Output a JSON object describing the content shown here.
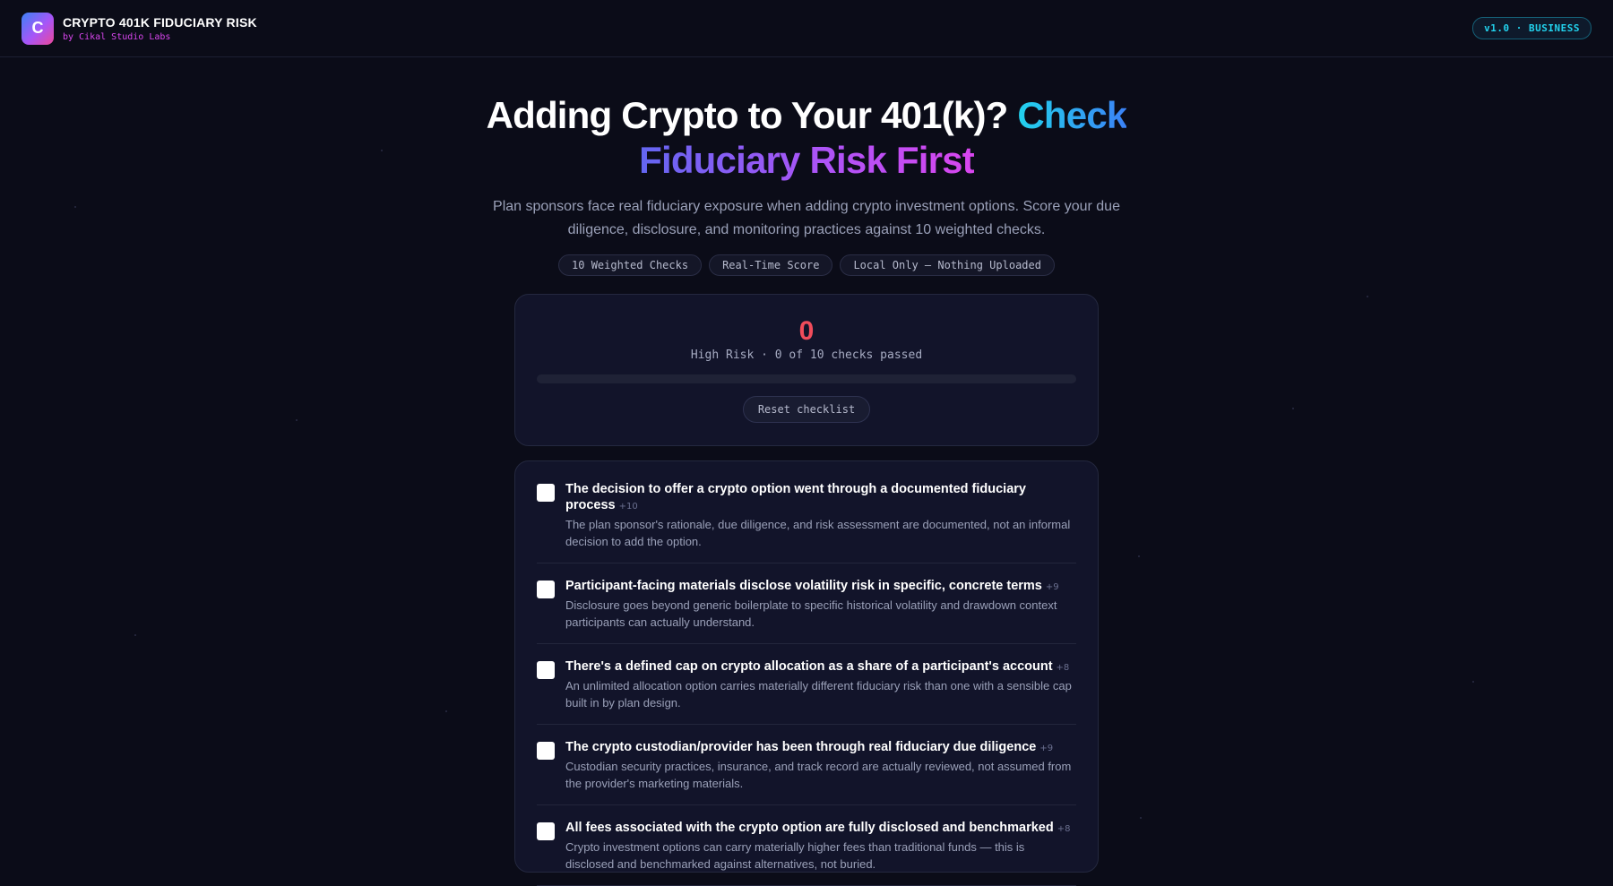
{
  "header": {
    "logo_letter": "C",
    "title": "CRYPTO 401K FIDUCIARY RISK",
    "subtitle": "by Cikal Studio Labs",
    "version": "v1.0 · BUSINESS"
  },
  "hero": {
    "title_plain": "Adding Crypto to Your 401(k)?",
    "title_accent1": "Check",
    "title_accent2": "Fiduciary Risk First",
    "description": "Plan sponsors face real fiduciary exposure when adding crypto investment options. Score your due diligence, disclosure, and monitoring practices against 10 weighted checks.",
    "pills": [
      "10 Weighted Checks",
      "Real-Time Score",
      "Local Only — Nothing Uploaded"
    ]
  },
  "score": {
    "value": "0",
    "label": "High Risk · 0 of 10 checks passed",
    "progress_fraction": 0,
    "reset_label": "Reset checklist",
    "risk_color": "#f14c5b"
  },
  "checks": [
    {
      "title": "The decision to offer a crypto option went through a documented fiduciary process",
      "weight": "+10",
      "desc": "The plan sponsor's rationale, due diligence, and risk assessment are documented, not an informal decision to add the option.",
      "checked": false
    },
    {
      "title": "Participant-facing materials disclose volatility risk in specific, concrete terms",
      "weight": "+9",
      "desc": "Disclosure goes beyond generic boilerplate to specific historical volatility and drawdown context participants can actually understand.",
      "checked": false
    },
    {
      "title": "There's a defined cap on crypto allocation as a share of a participant's account",
      "weight": "+8",
      "desc": "An unlimited allocation option carries materially different fiduciary risk than one with a sensible cap built in by plan design.",
      "checked": false
    },
    {
      "title": "The crypto custodian/provider has been through real fiduciary due diligence",
      "weight": "+9",
      "desc": "Custodian security practices, insurance, and track record are actually reviewed, not assumed from the provider's marketing materials.",
      "checked": false
    },
    {
      "title": "All fees associated with the crypto option are fully disclosed and benchmarked",
      "weight": "+8",
      "desc": "Crypto investment options can carry materially higher fees than traditional funds — this is disclosed and benchmarked against alternatives, not buried.",
      "checked": false
    }
  ]
}
